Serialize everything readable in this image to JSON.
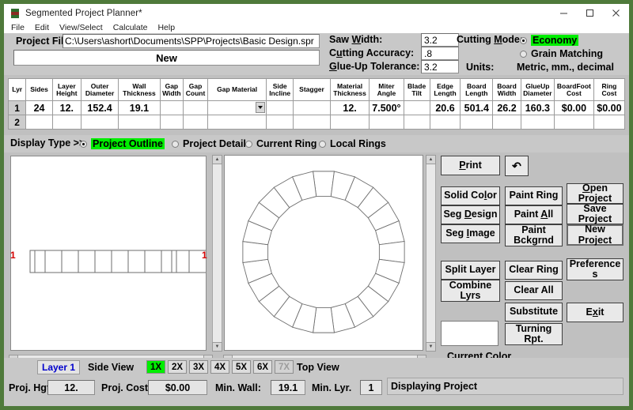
{
  "window": {
    "title": "Segmented Project Planner*",
    "icon": "app-icon",
    "minimize": "minimize-icon",
    "maximize": "maximize-icon",
    "close": "close-icon"
  },
  "menu": [
    "File",
    "Edit",
    "View/Select",
    "Calculate",
    "Help"
  ],
  "project": {
    "file_label": "Project File",
    "file_value": "C:\\Users\\ashort\\Documents\\SPP\\Projects\\Basic Design.spr",
    "name_value": "New"
  },
  "params": {
    "saw_width_label": "Saw Width:",
    "saw_width_value": "3.2",
    "cutting_accuracy_label": "Cutting Accuracy:",
    "cutting_accuracy_value": ".8",
    "glue_up_tolerance_label": "Glue-Up Tolerance:",
    "glue_up_tolerance_value": "3.2",
    "cutting_mode_label": "Cutting Mode:",
    "mode_economy": "Economy",
    "mode_grain": "Grain Matching",
    "units_label": "Units:",
    "units_value": "Metric, mm., decimal",
    "highlight_color": "#00ee00"
  },
  "table": {
    "headers": [
      "Lyr",
      "Sides",
      "Layer Height",
      "Outer Diameter",
      "Wall Thickness",
      "Gap Width",
      "Gap Count",
      "Gap Material",
      "Side Incline",
      "Stagger",
      "Material Thickness",
      "Miter Angle",
      "Blade Tilt",
      "Edge Length",
      "Board Length",
      "Board Width",
      "GlueUp Diameter",
      "BoardFoot Cost",
      "Ring Cost"
    ],
    "rows": [
      [
        "1",
        "24",
        "12.",
        "152.4",
        "19.1",
        "",
        "",
        "",
        "",
        "",
        "12.",
        "7.500°",
        "",
        "20.6",
        "501.4",
        "26.2",
        "160.3",
        "$0.00",
        "$0.00"
      ],
      [
        "2",
        "",
        "",
        "",
        "",
        "",
        "",
        "",
        "",
        "",
        "",
        "",
        "",
        "",
        "",
        "",
        "",
        "",
        ""
      ]
    ],
    "highlight_cell": "160.3"
  },
  "display_type": {
    "label": "Display Type >>",
    "options": [
      "Project Outline",
      "Project Detail",
      "Current Ring",
      "Local Rings"
    ],
    "selected": "Project Outline"
  },
  "views": {
    "side_view_label": "Side View",
    "top_view_label": "Top View",
    "side_marker_left": "1",
    "side_marker_right": "1",
    "segment_count": 24,
    "side_segment_count": 12
  },
  "buttons": {
    "print": "Print",
    "undo": "undo-icon",
    "solid_color": "Solid Color",
    "seg_design": "Seg Design",
    "seg_image": "Seg Image",
    "paint_ring": "Paint Ring",
    "paint_all": "Paint All",
    "paint_bckgrnd": "Paint Bckgrnd",
    "open_project": "Open Project",
    "save_project": "Save Project",
    "new_project": "New Project",
    "split_layer": "Split Layer",
    "combine_lyrs": "Combine Lyrs",
    "clear_ring": "Clear Ring",
    "clear_all": "Clear All",
    "substitute": "Substitute",
    "turning_rpt": "Turning Rpt.",
    "preferences": "Preferences",
    "exit": "Exit",
    "current_color_label": "Current Color"
  },
  "bottom": {
    "layer_button": "Layer 1",
    "zoom_levels": [
      "1X",
      "2X",
      "3X",
      "4X",
      "5X",
      "6X",
      "7X"
    ],
    "zoom_selected": "1X",
    "zoom_disabled": "7X",
    "proj_hgt_label": "Proj. Hgt",
    "proj_hgt_value": "12.",
    "proj_cost_label": "Proj. Cost",
    "proj_cost_value": "$0.00",
    "min_wall_label": "Min. Wall:",
    "min_wall_value": "19.1",
    "min_lyr_label": "Min. Lyr.",
    "min_lyr_value": "1",
    "status": "Displaying Project"
  }
}
